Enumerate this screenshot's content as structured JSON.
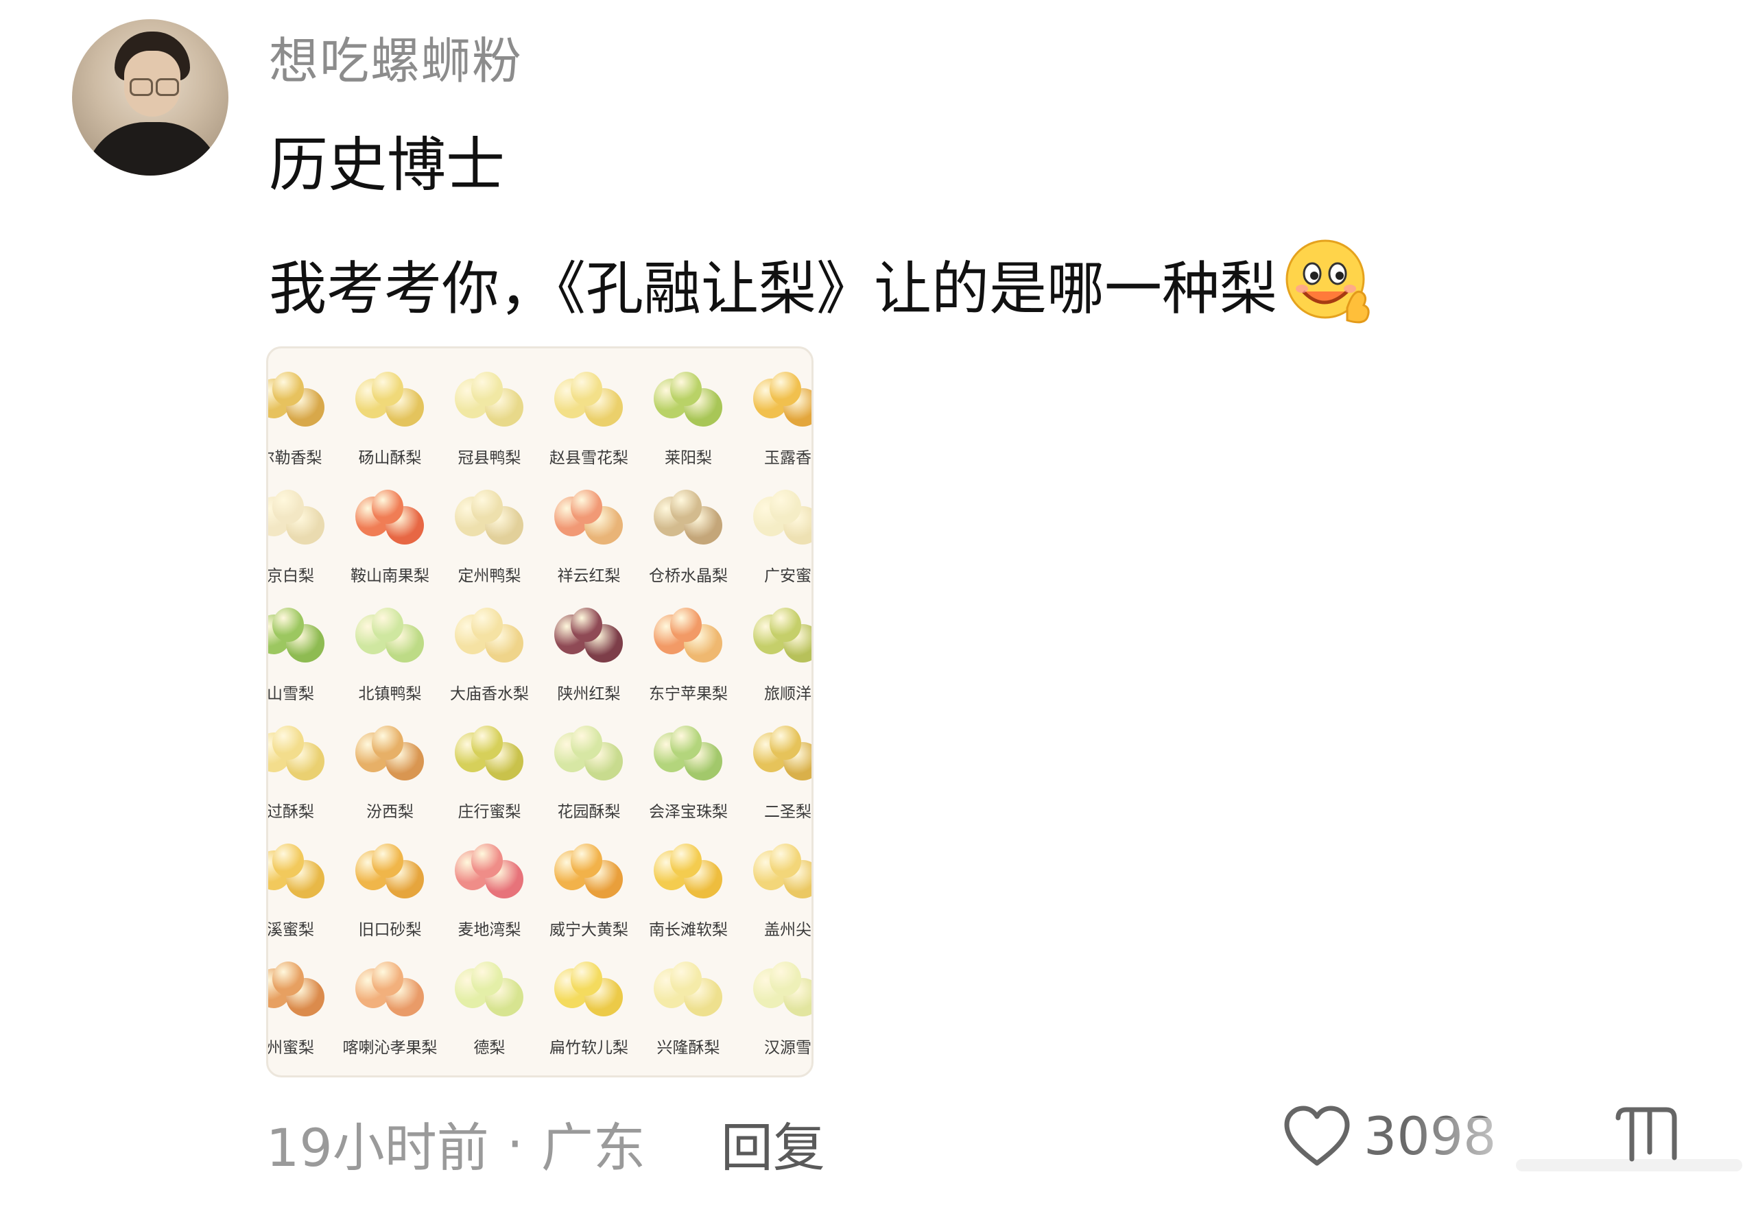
{
  "comment": {
    "username": "想吃螺蛳粉",
    "line1": "历史博士",
    "line2": "我考考你，《孔融让梨》让的是哪一种梨",
    "emoji_icon": "grin-wink-emoji-icon",
    "image": {
      "pears": [
        {
          "name": "库尔勒香梨",
          "visible": "尔勒香梨",
          "c1": "#e7c25e",
          "c2": "#d8a84a"
        },
        {
          "name": "砀山酥梨",
          "visible": "砀山酥梨",
          "c1": "#f0d979",
          "c2": "#e4c45d"
        },
        {
          "name": "冠县鸭梨",
          "visible": "冠县鸭梨",
          "c1": "#f1e8a4",
          "c2": "#e8d98a"
        },
        {
          "name": "赵县雪花梨",
          "visible": "赵县雪花梨",
          "c1": "#f3e089",
          "c2": "#ebd06b"
        },
        {
          "name": "莱阳梨",
          "visible": "莱阳梨",
          "c1": "#b9d267",
          "c2": "#a8c657"
        },
        {
          "name": "玉露香",
          "visible": "玉露香",
          "c1": "#f1c04e",
          "c2": "#e3a63c"
        },
        {
          "name": "京白梨",
          "visible": "京白梨",
          "c1": "#f3e7c4",
          "c2": "#eadbb0"
        },
        {
          "name": "鞍山南果梨",
          "visible": "鞍山南果梨",
          "c1": "#f07d55",
          "c2": "#e76744"
        },
        {
          "name": "定州鸭梨",
          "visible": "定州鸭梨",
          "c1": "#eee0ad",
          "c2": "#e2d09a"
        },
        {
          "name": "祥云红梨",
          "visible": "祥云红梨",
          "c1": "#f19975",
          "c2": "#e9b477"
        },
        {
          "name": "仓桥水晶梨",
          "visible": "仓桥水晶梨",
          "c1": "#d3bb8e",
          "c2": "#c4a679"
        },
        {
          "name": "广安蜜",
          "visible": "广安蜜",
          "c1": "#f5edc6",
          "c2": "#eee1b3"
        },
        {
          "name": "山雪梨",
          "visible": "山雪梨",
          "c1": "#9cc760",
          "c2": "#8ebb52"
        },
        {
          "name": "北镇鸭梨",
          "visible": "北镇鸭梨",
          "c1": "#cfe7a0",
          "c2": "#bddb86"
        },
        {
          "name": "大庙香水梨",
          "visible": "大庙香水梨",
          "c1": "#f5e2a3",
          "c2": "#efd48a"
        },
        {
          "name": "陕州红梨",
          "visible": "陕州红梨",
          "c1": "#8f4a55",
          "c2": "#7d3e49"
        },
        {
          "name": "东宁苹果梨",
          "visible": "东宁苹果梨",
          "c1": "#f29a66",
          "c2": "#efb870"
        },
        {
          "name": "旅顺洋",
          "visible": "旅顺洋",
          "c1": "#c5cf6a",
          "c2": "#b7c15a"
        },
        {
          "name": "过酥梨",
          "visible": "过酥梨",
          "c1": "#f3dd8c",
          "c2": "#ead071"
        },
        {
          "name": "汾西梨",
          "visible": "汾西梨",
          "c1": "#e7b067",
          "c2": "#d99651"
        },
        {
          "name": "庄行蜜梨",
          "visible": "庄行蜜梨",
          "c1": "#d6d05a",
          "c2": "#c9c24b"
        },
        {
          "name": "花园酥梨",
          "visible": "花园酥梨",
          "c1": "#d7e7a4",
          "c2": "#c8db8e"
        },
        {
          "name": "会泽宝珠梨",
          "visible": "会泽宝珠梨",
          "c1": "#b3d57c",
          "c2": "#a2c86b"
        },
        {
          "name": "二圣梨",
          "visible": "二圣梨",
          "c1": "#e6c35a",
          "c2": "#d9b04a"
        },
        {
          "name": "溪蜜梨",
          "visible": "溪蜜梨",
          "c1": "#f2c95c",
          "c2": "#e8b847"
        },
        {
          "name": "旧口砂梨",
          "visible": "旧口砂梨",
          "c1": "#f0b64a",
          "c2": "#e6a53d"
        },
        {
          "name": "麦地湾梨",
          "visible": "麦地湾梨",
          "c1": "#ef8d88",
          "c2": "#e7737a"
        },
        {
          "name": "威宁大黄梨",
          "visible": "威宁大黄梨",
          "c1": "#f2b24a",
          "c2": "#e99f3b"
        },
        {
          "name": "南长滩软梨",
          "visible": "南长滩软梨",
          "c1": "#f4cc4f",
          "c2": "#eebd3e"
        },
        {
          "name": "盖州尖",
          "visible": "盖州尖",
          "c1": "#f3d679",
          "c2": "#ebc863"
        },
        {
          "name": "州蜜梨",
          "visible": "州蜜梨",
          "c1": "#e7a061",
          "c2": "#db8b4c"
        },
        {
          "name": "喀喇沁孝果梨",
          "visible": "喀喇沁孝果梨",
          "c1": "#f2b07c",
          "c2": "#e99b68"
        },
        {
          "name": "德梨",
          "visible": "德梨",
          "c1": "#e4efa8",
          "c2": "#d7e490"
        },
        {
          "name": "扁竹软儿梨",
          "visible": "扁竹软儿梨",
          "c1": "#f4db5e",
          "c2": "#ecca48"
        },
        {
          "name": "兴隆酥梨",
          "visible": "兴隆酥梨",
          "c1": "#f5eba9",
          "c2": "#eee08e"
        },
        {
          "name": "汉源雪",
          "visible": "汉源雪",
          "c1": "#eef0b8",
          "c2": "#e2e59f"
        }
      ]
    },
    "time": "19小时前",
    "separator": "·",
    "location": "广东",
    "reply_label": "回复",
    "like_icon": "heart-outline-icon",
    "like_count": "3098",
    "dislike_icon": "thumbs-down-outline-icon"
  }
}
